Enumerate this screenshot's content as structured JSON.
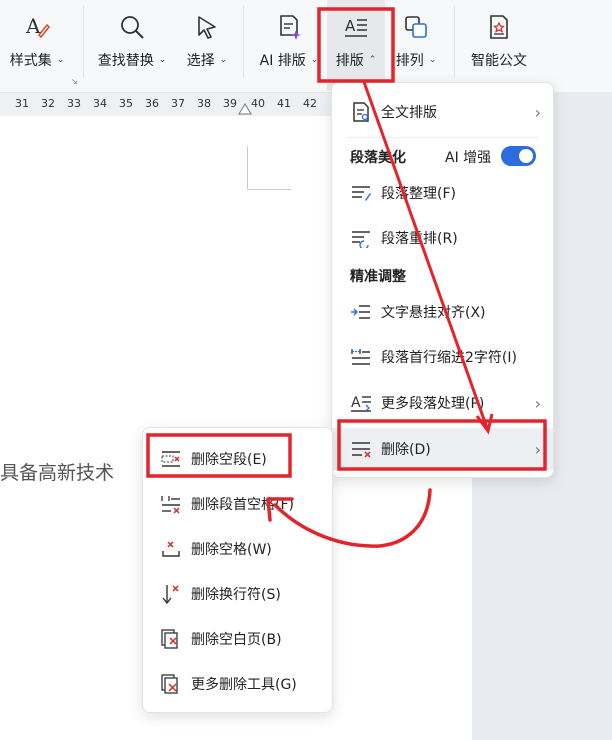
{
  "toolbar": {
    "items": [
      {
        "label": "样式集",
        "caret": "⌄",
        "icon": "style-set-icon"
      },
      {
        "label": "查找替换",
        "caret": "⌄",
        "icon": "search-icon"
      },
      {
        "label": "选择",
        "caret": "⌄",
        "icon": "cursor-icon"
      },
      {
        "label": "AI 排版",
        "caret": "⌄",
        "icon": "ai-layout-icon"
      },
      {
        "label": "排版",
        "caret": "⌃",
        "icon": "layout-icon"
      },
      {
        "label": "排列",
        "caret": "⌄",
        "icon": "arrange-icon"
      },
      {
        "label": "智能公文",
        "caret": "",
        "icon": "official-doc-icon"
      }
    ],
    "corner_mark": "↘"
  },
  "ruler": {
    "numbers": [
      "31",
      "32",
      "33",
      "34",
      "35",
      "36",
      "37",
      "38",
      "39",
      "40",
      "41",
      "42"
    ]
  },
  "document": {
    "text": "具备高新技术"
  },
  "layout_menu": {
    "full_text_layout": "全文排版",
    "section_beautify": "段落美化",
    "ai_enhance": "AI 增强",
    "ai_enabled": true,
    "paragraph_tidy": "段落整理(F)",
    "paragraph_rearrange": "段落重排(R)",
    "section_precise": "精准调整",
    "text_hanging_align": "文字悬挂对齐(X)",
    "first_line_indent": "段落首行缩进2字符(I)",
    "more_paragraph": "更多段落处理(P)",
    "delete": "删除(D)",
    "arrow": "›"
  },
  "delete_submenu": {
    "items": [
      {
        "label": "删除空段(E)",
        "icon": "delete-empty-paragraph-icon"
      },
      {
        "label": "删除段首空格(F)",
        "icon": "delete-leading-space-icon"
      },
      {
        "label": "删除空格(W)",
        "icon": "delete-space-icon"
      },
      {
        "label": "删除换行符(S)",
        "icon": "delete-line-break-icon"
      },
      {
        "label": "删除空白页(B)",
        "icon": "delete-blank-page-icon"
      },
      {
        "label": "更多删除工具(G)",
        "icon": "more-delete-tools-icon"
      }
    ]
  },
  "colors": {
    "annotation_red": "#e3242b",
    "accent_blue": "#2d6cdf"
  }
}
